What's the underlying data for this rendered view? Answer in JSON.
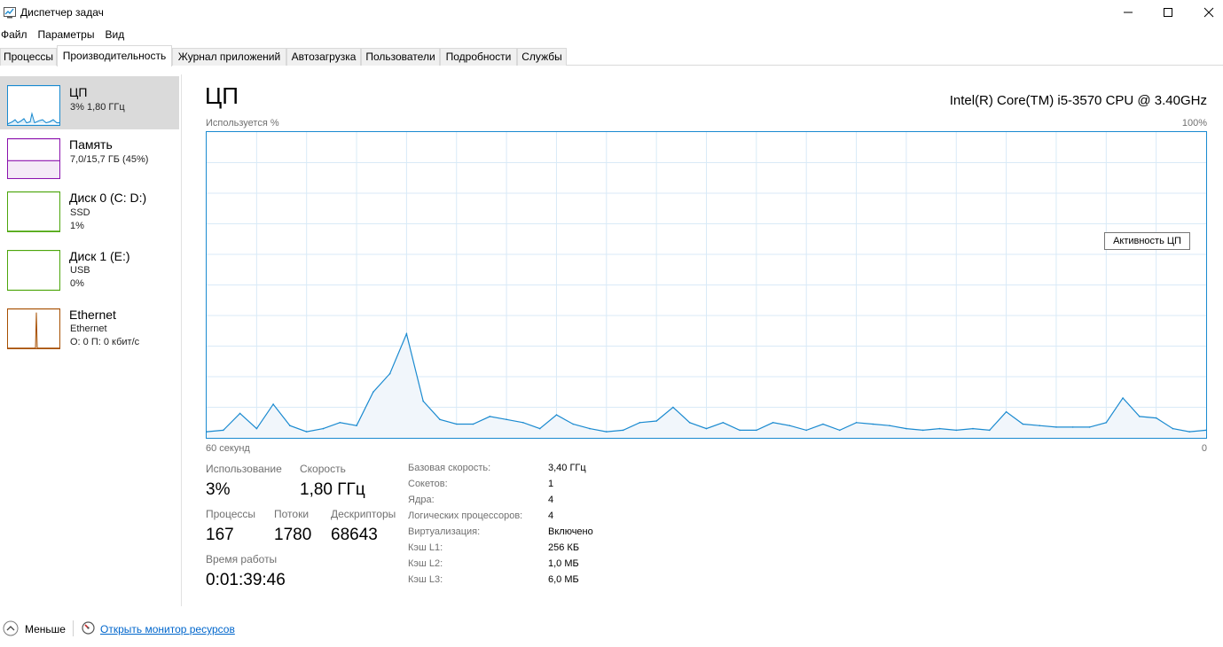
{
  "window": {
    "title": "Диспетчер задач"
  },
  "menu": [
    "Файл",
    "Параметры",
    "Вид"
  ],
  "tabs": [
    "Процессы",
    "Производительность",
    "Журнал приложений",
    "Автозагрузка",
    "Пользователи",
    "Подробности",
    "Службы"
  ],
  "active_tab": "Производительность",
  "resources": [
    {
      "title": "ЦП",
      "line1": "3%  1,80 ГГц",
      "line2": "",
      "color": "#1a8ad0"
    },
    {
      "title": "Память",
      "line1": "7,0/15,7 ГБ (45%)",
      "line2": "",
      "color": "#8b12ae"
    },
    {
      "title": "Диск 0 (C: D:)",
      "line1": "SSD",
      "line2": "1%",
      "color": "#4da60c"
    },
    {
      "title": "Диск 1 (E:)",
      "line1": "USB",
      "line2": "0%",
      "color": "#4da60c"
    },
    {
      "title": "Ethernet",
      "line1": "Ethernet",
      "line2": "О: 0 П: 0 кбит/с",
      "color": "#a74f01"
    }
  ],
  "main": {
    "title": "ЦП",
    "cpu_model": "Intel(R) Core(TM) i5-3570 CPU @ 3.40GHz",
    "graph_label_top_left": "Используется %",
    "graph_label_top_right": "100%",
    "graph_label_bottom_left": "60 секунд",
    "graph_label_bottom_right": "0",
    "tooltip": "Активность ЦП"
  },
  "stats": {
    "usage_label": "Использование",
    "usage_value": "3%",
    "speed_label": "Скорость",
    "speed_value": "1,80 ГГц",
    "processes_label": "Процессы",
    "processes_value": "167",
    "threads_label": "Потоки",
    "threads_value": "1780",
    "handles_label": "Дескрипторы",
    "handles_value": "68643",
    "uptime_label": "Время работы",
    "uptime_value": "0:01:39:46"
  },
  "info": [
    {
      "label": "Базовая скорость:",
      "value": "3,40 ГГц"
    },
    {
      "label": "Сокетов:",
      "value": "1"
    },
    {
      "label": "Ядра:",
      "value": "4"
    },
    {
      "label": "Логических процессоров:",
      "value": "4"
    },
    {
      "label": "Виртуализация:",
      "value": "Включено"
    },
    {
      "label": "Кэш L1:",
      "value": "256 КБ"
    },
    {
      "label": "Кэш L2:",
      "value": "1,0 МБ"
    },
    {
      "label": "Кэш L3:",
      "value": "6,0 МБ"
    }
  ],
  "footer": {
    "less_label": "Меньше",
    "monitor_link": "Открыть монитор ресурсов"
  },
  "chart_data": {
    "type": "area",
    "title": "",
    "ylabel": "Используется %",
    "ylim": [
      0,
      100
    ],
    "xlim": [
      60,
      0
    ],
    "series": [
      {
        "values": [
          2,
          2.5,
          8,
          3,
          11,
          4,
          2,
          3,
          5,
          4,
          15,
          21,
          34,
          12,
          6,
          4.5,
          4.5,
          7,
          6,
          5,
          3,
          7.5,
          4.5,
          3,
          2,
          2.5,
          5,
          5.5,
          10,
          5,
          3,
          5,
          2.5,
          2.5,
          5,
          4,
          2.5,
          4.5,
          2.5,
          5,
          4.5,
          4,
          3,
          2.5,
          3,
          2.5,
          3,
          2.5,
          8.5,
          4.5,
          4,
          3.5,
          3.5,
          3.5,
          5,
          13,
          7,
          6.5,
          3,
          2,
          2.5
        ]
      }
    ]
  }
}
